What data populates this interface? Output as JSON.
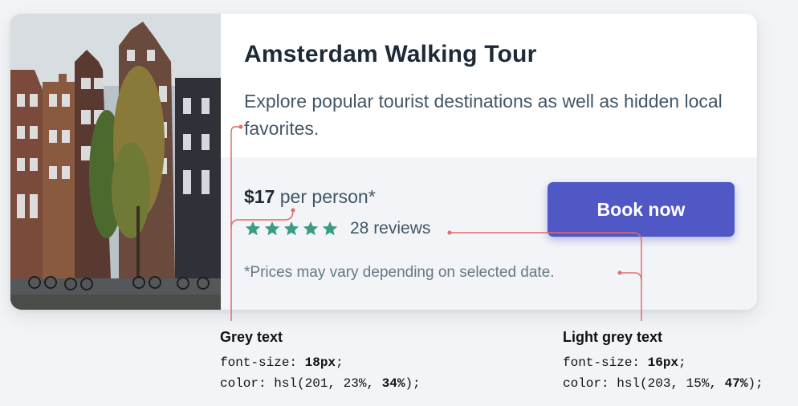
{
  "card": {
    "title": "Amsterdam Walking Tour",
    "description": "Explore popular tourist destinations as well as hidden local favorites.",
    "price": {
      "amount": "$17",
      "unit": "per person*"
    },
    "rating": {
      "stars": 5,
      "reviews_label": "28 reviews",
      "star_color": "#3a9d82"
    },
    "disclaimer": "*Prices may vary depending on selected date.",
    "book_button_label": "Book now",
    "button_color": "#5058c5"
  },
  "annotations": {
    "grey": {
      "heading": "Grey text",
      "prop1": "font-size: ",
      "val1": "18px",
      "semi1": ";",
      "prop2": "color: hsl(201, 23%, ",
      "val2": "34%",
      "semi2": ");"
    },
    "light_grey": {
      "heading": "Light grey text",
      "prop1": "font-size: ",
      "val1": "16px",
      "semi1": ";",
      "prop2": "color: hsl(203, 15%, ",
      "val2": "47%",
      "semi2": ");"
    },
    "line_color": "#e26b6b"
  },
  "icons": {
    "star": "star-icon"
  }
}
